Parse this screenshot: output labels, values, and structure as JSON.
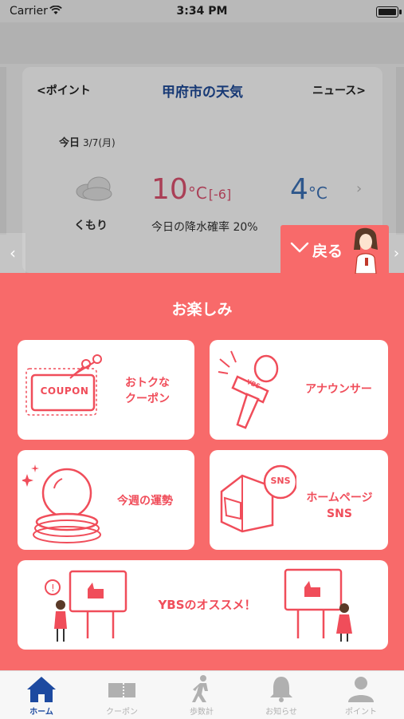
{
  "status_bar": {
    "carrier": "Carrier",
    "time": "3:34 PM",
    "battery_level": 1.0
  },
  "weather_card": {
    "prev_link": "<ポイント",
    "title": "甲府市の天気",
    "next_link": "ニュース>",
    "today_label": "今日",
    "date": "3/7(月)",
    "condition": "くもり",
    "condition_icon": "cloud-icon",
    "high_temp": "10",
    "high_unit": "°C",
    "high_diff": "[-6]",
    "low_temp": "4",
    "low_unit": "°C",
    "rain_label": "今日の降水確率",
    "rain_value": "20%",
    "colors": {
      "title": "#1f4c9a",
      "high": "#e05372",
      "low": "#3d73b8"
    }
  },
  "back_tab": {
    "label": "戻る"
  },
  "panel": {
    "title": "お楽しみ",
    "accent": "#f86a6a",
    "tiles": [
      {
        "label_line1": "おトクな",
        "label_line2": "クーポン",
        "icon": "coupon-scissors-icon",
        "badge": "COUPON"
      },
      {
        "label_line1": "アナウンサー",
        "icon": "microphone-icon",
        "badge": "YBS"
      },
      {
        "label_line1": "今週の運勢",
        "icon": "crystal-ball-icon"
      },
      {
        "label_line1": "ホームページ",
        "label_line2": "SNS",
        "icon": "sns-box-icon",
        "badge": "SNS"
      },
      {
        "label_line1": "YBSのオススメ！",
        "icon": "recommend-billboard-icon"
      }
    ]
  },
  "tabbar": {
    "active_color": "#1d4aa0",
    "items": [
      {
        "label": "ホーム",
        "icon": "home-icon",
        "active": true
      },
      {
        "label": "クーポン",
        "icon": "ticket-icon",
        "active": false
      },
      {
        "label": "歩数計",
        "icon": "walking-icon",
        "active": false
      },
      {
        "label": "お知らせ",
        "icon": "bell-icon",
        "active": false
      },
      {
        "label": "ポイント",
        "icon": "person-icon",
        "active": false
      }
    ]
  }
}
